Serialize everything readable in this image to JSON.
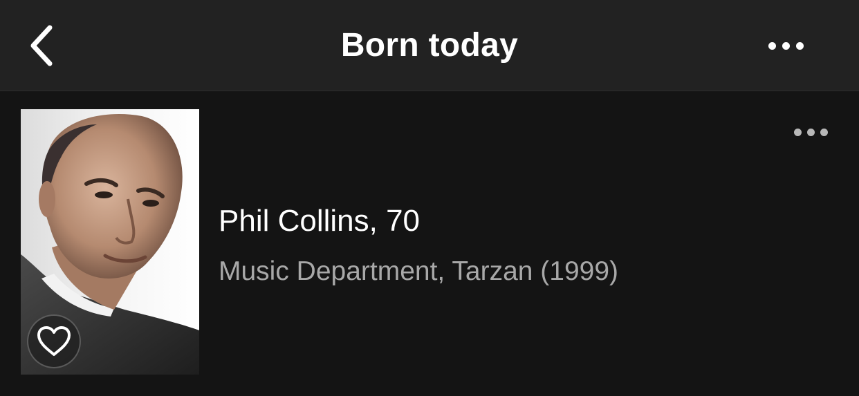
{
  "header": {
    "title": "Born today",
    "back_icon": "chevron-left-icon",
    "more_icon": "ellipsis-icon"
  },
  "person": {
    "name_age": "Phil Collins, 70",
    "known_for": "Music Department, Tarzan (1999)",
    "favorite_icon": "heart-outline-icon",
    "more_icon": "ellipsis-icon"
  },
  "colors": {
    "header_bg": "#222222",
    "body_bg": "#141414",
    "primary_text": "#ffffff",
    "secondary_text": "#a8a8a8"
  }
}
